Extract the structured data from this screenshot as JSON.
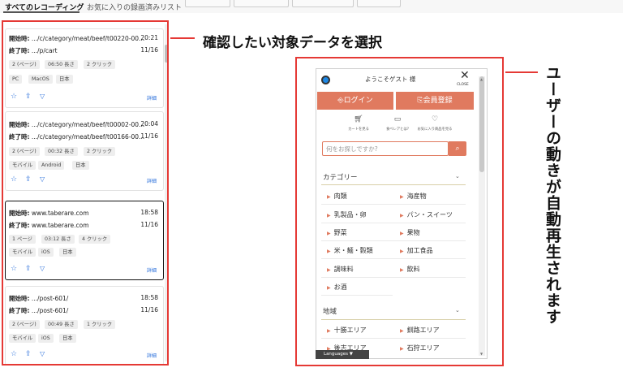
{
  "tabs": {
    "all": "すべてのレコーディング",
    "favorites": "お気に入りの録画済みリスト"
  },
  "annotations": {
    "select_label": "確認したい対象データを選択",
    "autoplay_label": "ユーザーの動きが自動再生されます"
  },
  "recordings": [
    {
      "start_label": "開始時:",
      "start_url": ".../c/category/meat/beef/t00220-00...",
      "start_time": "20:21",
      "end_label": "終了時:",
      "end_url": ".../p/cart",
      "end_date": "11/16",
      "chips1": [
        "2 (ページ)",
        "06:50 長さ",
        "2 クリック"
      ],
      "chips2": [
        "PC",
        "MacOS",
        "日本"
      ],
      "detail": "詳細"
    },
    {
      "start_label": "開始時:",
      "start_url": ".../c/category/meat/beef/t00002-00...",
      "start_time": "20:04",
      "end_label": "終了時:",
      "end_url": ".../c/category/meat/beef/t00166-00...",
      "end_date": "11/16",
      "chips1": [
        "2 (ページ)",
        "00:32 長さ",
        "2 クリック"
      ],
      "chips2": [
        "モバイル",
        "Android",
        "日本"
      ],
      "detail": "詳細"
    },
    {
      "start_label": "開始時:",
      "start_url": "www.taberare.com",
      "start_time": "18:58",
      "end_label": "終了時:",
      "end_url": "www.taberare.com",
      "end_date": "11/16",
      "chips1": [
        "1 ページ",
        "03:12 長さ",
        "4 クリック"
      ],
      "chips2": [
        "モバイル",
        "iOS",
        "日本"
      ],
      "detail": "詳細"
    },
    {
      "start_label": "開始時:",
      "start_url": ".../post-601/",
      "start_time": "18:58",
      "end_label": "終了時:",
      "end_url": ".../post-601/",
      "end_date": "11/16",
      "chips1": [
        "2 (ページ)",
        "00:49 長さ",
        "1 クリック"
      ],
      "chips2": [
        "モバイル",
        "iOS",
        "日本"
      ],
      "detail": "詳細"
    }
  ],
  "site": {
    "greeting": "ようこそゲスト 様",
    "close_label": "CLOSE",
    "login_label": "⎆ログイン",
    "register_label": "⎘会員登録",
    "mini_nav": [
      {
        "icon": "cart-icon",
        "label": "カートを見る"
      },
      {
        "icon": "shop-icon",
        "label": "食べレアとは?"
      },
      {
        "icon": "heart-icon",
        "label": "お気に入り商品を見る"
      }
    ],
    "search_placeholder": "何をお探しですか?",
    "categories_title": "カテゴリー",
    "categories": [
      "肉類",
      "海産物",
      "乳製品・卵",
      "パン・スイーツ",
      "野菜",
      "果物",
      "米・麺・穀類",
      "加工食品",
      "調味料",
      "飲料",
      "お酒"
    ],
    "regions_title": "地域",
    "regions": [
      "十勝エリア",
      "釧路エリア",
      "後志エリア",
      "石狩エリア"
    ],
    "languages_label": "Languages"
  }
}
